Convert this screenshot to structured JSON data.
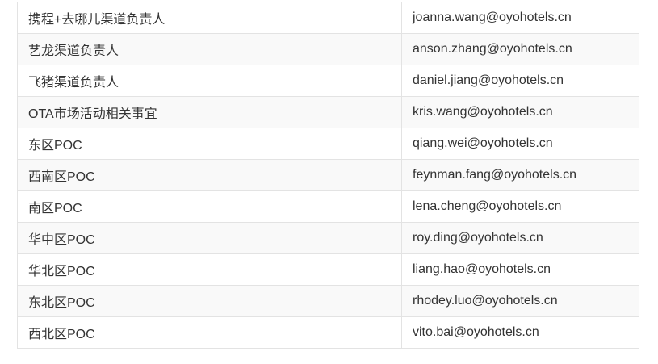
{
  "contacts": [
    {
      "role": "携程+去哪儿渠道负责人",
      "email": "joanna.wang@oyohotels.cn"
    },
    {
      "role": "艺龙渠道负责人",
      "email": "anson.zhang@oyohotels.cn"
    },
    {
      "role": "飞猪渠道负责人",
      "email": "daniel.jiang@oyohotels.cn"
    },
    {
      "role": "OTA市场活动相关事宜",
      "email": "kris.wang@oyohotels.cn"
    },
    {
      "role": "东区POC",
      "email": "qiang.wei@oyohotels.cn"
    },
    {
      "role": "西南区POC",
      "email": "feynman.fang@oyohotels.cn"
    },
    {
      "role": "南区POC",
      "email": "lena.cheng@oyohotels.cn"
    },
    {
      "role": "华中区POC",
      "email": "roy.ding@oyohotels.cn"
    },
    {
      "role": "华北区POC",
      "email": "liang.hao@oyohotels.cn"
    },
    {
      "role": "东北区POC",
      "email": "rhodey.luo@oyohotels.cn"
    },
    {
      "role": "西北区POC",
      "email": "vito.bai@oyohotels.cn"
    }
  ]
}
